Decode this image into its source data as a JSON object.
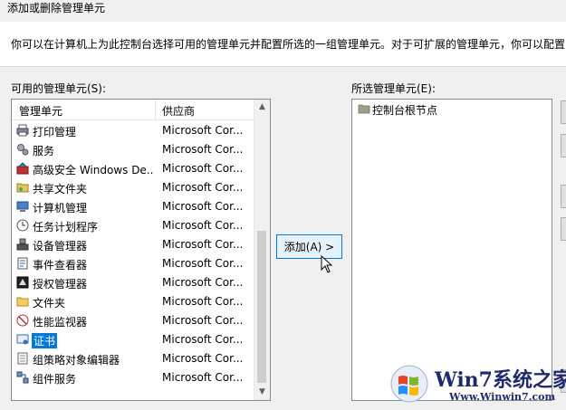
{
  "window": {
    "title": "添加或删除管理单元"
  },
  "description": "你可以在计算机上为此控制台选择可用的管理单元并配置所选的一组管理单元。对于可扩展的管理单元，你可以配置",
  "available": {
    "label": "可用的管理单元(S):",
    "columns": [
      "管理单元",
      "供应商"
    ],
    "rows": [
      {
        "name": "打印管理",
        "vendor": "Microsoft Cor...",
        "icon": "printer-icon"
      },
      {
        "name": "服务",
        "vendor": "Microsoft Cor...",
        "icon": "gears-icon"
      },
      {
        "name": "高级安全 Windows De...",
        "vendor": "Microsoft Cor...",
        "icon": "firewall-icon"
      },
      {
        "name": "共享文件夹",
        "vendor": "Microsoft Cor...",
        "icon": "shared-folder-icon"
      },
      {
        "name": "计算机管理",
        "vendor": "Microsoft Cor...",
        "icon": "computer-management-icon"
      },
      {
        "name": "任务计划程序",
        "vendor": "Microsoft Cor...",
        "icon": "clock-icon"
      },
      {
        "name": "设备管理器",
        "vendor": "Microsoft Cor...",
        "icon": "device-manager-icon"
      },
      {
        "name": "事件查看器",
        "vendor": "Microsoft Cor...",
        "icon": "event-viewer-icon"
      },
      {
        "name": "授权管理器",
        "vendor": "Microsoft Cor...",
        "icon": "authorization-icon"
      },
      {
        "name": "文件夹",
        "vendor": "Microsoft Cor...",
        "icon": "folder-icon"
      },
      {
        "name": "性能监视器",
        "vendor": "Microsoft Cor...",
        "icon": "performance-monitor-icon"
      },
      {
        "name": "证书",
        "vendor": "Microsoft Cor...",
        "icon": "certificate-icon",
        "selected": true
      },
      {
        "name": "组策略对象编辑器",
        "vendor": "Microsoft Cor...",
        "icon": "group-policy-icon"
      },
      {
        "name": "组件服务",
        "vendor": "Microsoft Cor...",
        "icon": "component-services-icon"
      }
    ]
  },
  "add_button": "添加(A) >",
  "selected": {
    "label": "所选管理单元(E):",
    "root": "控制台根节点"
  },
  "watermark": {
    "title": "Win7系统之家",
    "url": "Www.Winwin7.com"
  },
  "colors": {
    "selection": "#0078d7",
    "button_border": "#0078d7",
    "button_fill": "#e5f1fb"
  }
}
